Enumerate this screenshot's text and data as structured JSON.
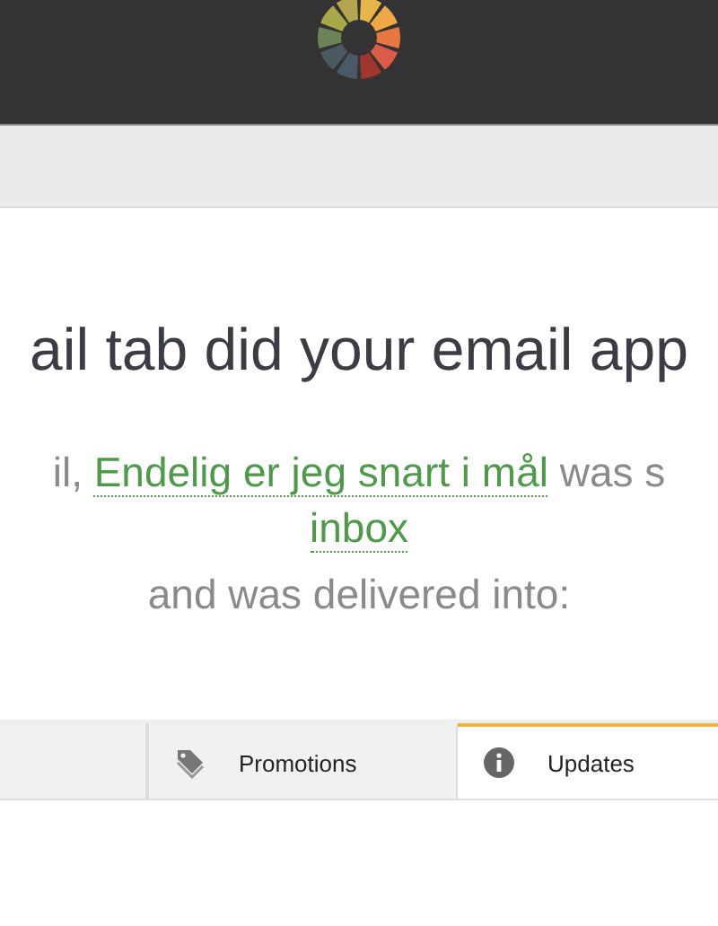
{
  "question": {
    "title": "ail tab did your email app",
    "lead": "il, ",
    "subject_link": "Endelig er jeg snart i mål",
    "tail": " was s",
    "folder_link": "inbox",
    "note": "and was delivered into:"
  },
  "tabs": [
    {
      "label": "Promotions",
      "kind": "tag",
      "selected": false
    },
    {
      "label": "Updates",
      "kind": "info",
      "selected": true
    }
  ]
}
